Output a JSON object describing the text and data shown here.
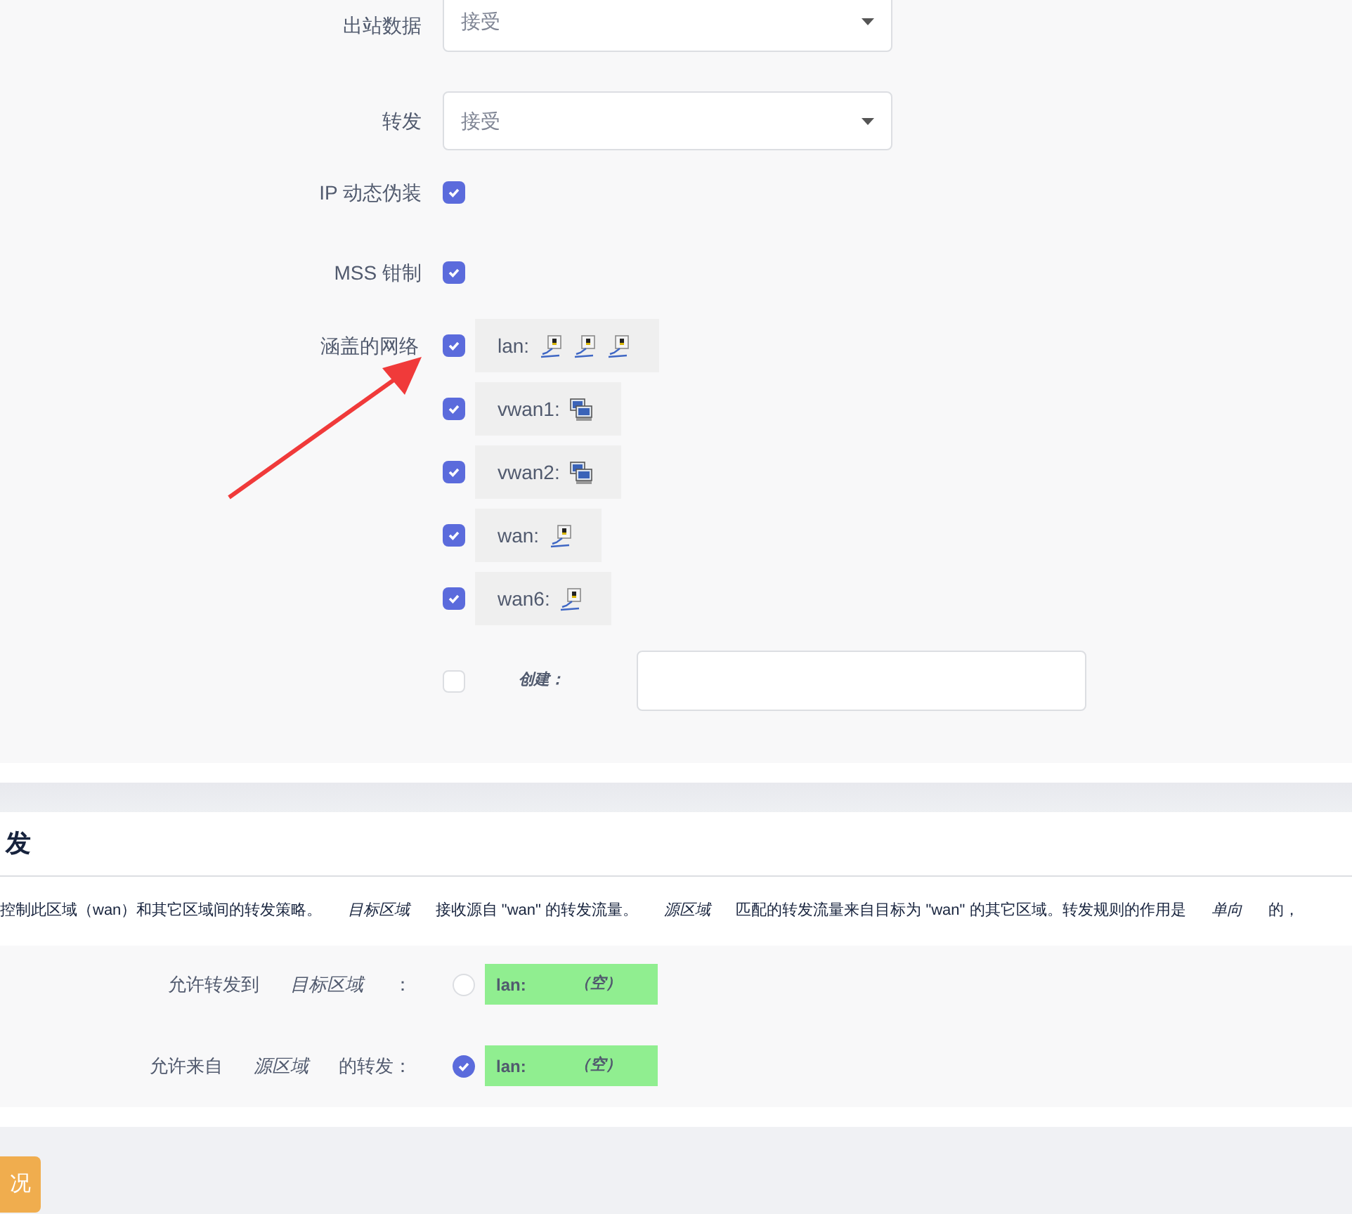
{
  "general": {
    "rows": [
      {
        "kind": "select",
        "label": "出站数据",
        "value": "接受"
      },
      {
        "kind": "select",
        "label": "转发",
        "value": "接受"
      },
      {
        "kind": "checkbox",
        "label": "IP 动态伪装",
        "checked": true
      },
      {
        "kind": "checkbox",
        "label": "MSS 钳制",
        "checked": true
      }
    ],
    "covered_networks": {
      "label": "涵盖的网络",
      "items": [
        {
          "name": "lan:",
          "checked": true,
          "kind": "bridge"
        },
        {
          "name": "vwan1:",
          "checked": true,
          "kind": "wireless"
        },
        {
          "name": "vwan2:",
          "checked": true,
          "kind": "wireless"
        },
        {
          "name": "wan:",
          "checked": true,
          "kind": "ethernet"
        },
        {
          "name": "wan6:",
          "checked": true,
          "kind": "ethernet"
        }
      ],
      "create": {
        "checked": false,
        "label": "创建："
      }
    }
  },
  "forwarding": {
    "title": "发",
    "description": "控制此区域（wan）和其它区域间的转发策略。      *目标区域*      接收源自 \"wan\" 的转发流量。      *源区域*      匹配的转发流量来自目标为 \"wan\" 的其它区域。转发规则的作用是      *单向*      的，",
    "rules": [
      {
        "label": "允许转发到      *目标区域*      ：",
        "checked": false,
        "zone": "lan:",
        "value": "（空）"
      },
      {
        "label": "允许来自      *源区域*      的转发：",
        "checked": true,
        "zone": "lan:",
        "value": "（空）"
      }
    ]
  },
  "footer_button": "况"
}
